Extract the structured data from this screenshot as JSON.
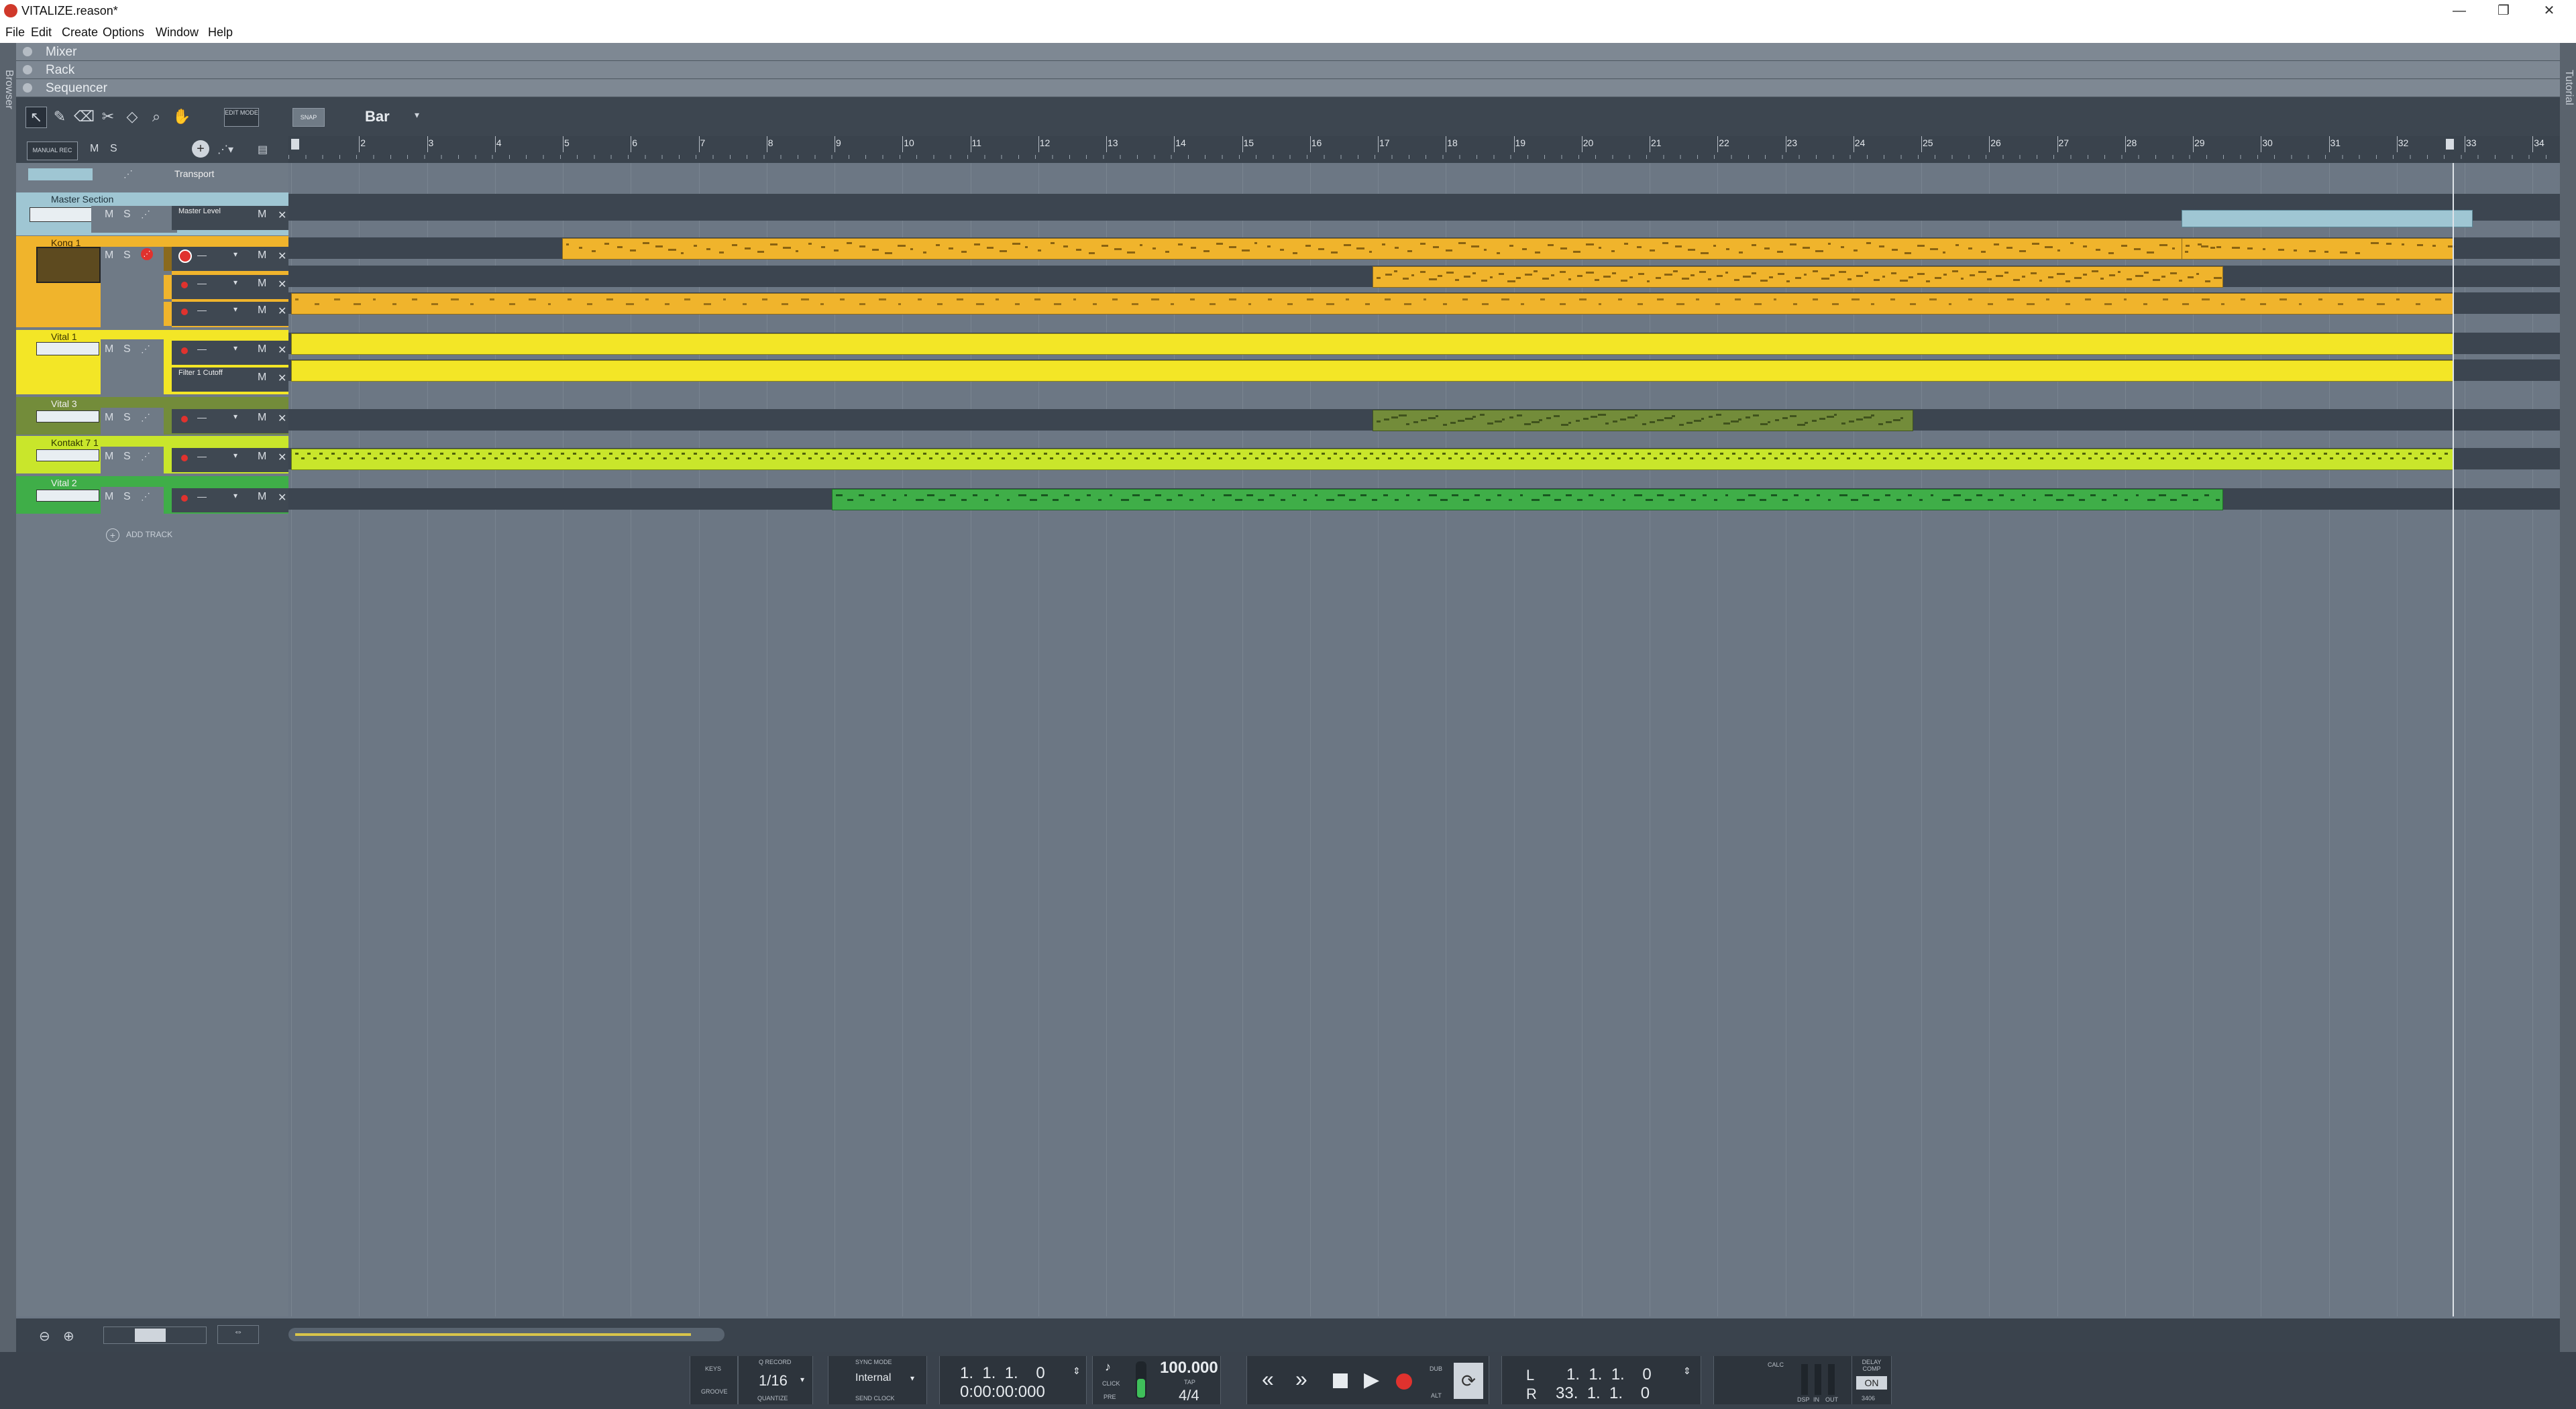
{
  "window": {
    "title": "VITALIZE.reason*",
    "minimize": "—",
    "restore": "❐",
    "close": "✕"
  },
  "menu": [
    "File",
    "Edit",
    "Create",
    "Options",
    "Window",
    "Help"
  ],
  "side": {
    "browser": "Browser",
    "tutorial": "Tutorial"
  },
  "sections": {
    "mixer": "Mixer",
    "rack": "Rack",
    "sequencer": "Sequencer"
  },
  "toolbar": {
    "edit_mode": "EDIT MODE",
    "snap": "SNAP",
    "snap_value": "Bar"
  },
  "header": {
    "manual_rec": "MANUAL REC",
    "m": "M",
    "s": "S",
    "transport": "Transport",
    "add_track": "ADD TRACK"
  },
  "tracks": [
    {
      "name": "Master Section",
      "lane": "Master Level",
      "color": "#9fc6d3"
    },
    {
      "name": "Kong 1",
      "color": "#f0b42c"
    },
    {
      "name": "Vital 1",
      "lane": "Filter 1 Cutoff",
      "color": "#f3e626"
    },
    {
      "name": "Vital 3",
      "color": "#738c3a"
    },
    {
      "name": "Kontakt 7 1",
      "color": "#c9e62b"
    },
    {
      "name": "Vital 2",
      "color": "#3fae48"
    }
  ],
  "ruler": [
    "2",
    "3",
    "4",
    "5",
    "6",
    "7",
    "8",
    "9",
    "10",
    "11",
    "12",
    "13",
    "14",
    "15",
    "16",
    "17",
    "18",
    "19",
    "20",
    "21",
    "22",
    "23",
    "24",
    "25",
    "26",
    "27",
    "28",
    "29",
    "30",
    "31",
    "32",
    "33",
    "34"
  ],
  "transport": {
    "keys": "KEYS",
    "groove": "GROOVE",
    "q_record": "Q RECORD",
    "quantize_value": "1/16",
    "quantize": "QUANTIZE",
    "sync_mode": "SYNC MODE",
    "sync_value": "Internal",
    "send_clock": "SEND CLOCK",
    "position": "1.  1.  1.    0",
    "time": "0:00:00:000",
    "click": "CLICK",
    "pre": "PRE",
    "tempo": "100.000",
    "tap": "TAP",
    "signature": "4/4",
    "dub": "DUB",
    "alt": "ALT",
    "loop_l_label": "L",
    "loop_r_label": "R",
    "loop_l": "1.  1.  1.    0",
    "loop_r": "33.  1.  1.    0",
    "dsp": "DSP",
    "in": "IN",
    "out": "OUT",
    "calc": "CALC",
    "delay_comp": "DELAY COMP",
    "delay_on": "ON",
    "delay_value": "3406"
  }
}
